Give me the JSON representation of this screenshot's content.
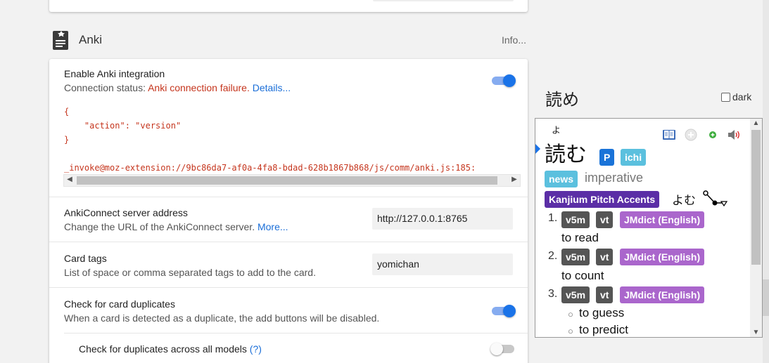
{
  "section": {
    "title": "Anki",
    "info_link": "Info..."
  },
  "anki_integration": {
    "label": "Enable Anki integration",
    "status_prefix": "Connection status: ",
    "status_value": "Anki connection failure.",
    "details_link": "Details...",
    "enabled": true,
    "error_lines": [
      "{",
      "    \"action\": \"version\"",
      "}",
      "_invoke@moz-extension://9bc86da7-af0a-4fa8-bdad-628b1867b868/js/comm/anki.js:185:"
    ]
  },
  "server_address": {
    "label": "AnkiConnect server address",
    "description": "Change the URL of the AnkiConnect server.",
    "more_link": "More...",
    "value": "http://127.0.0.1:8765"
  },
  "card_tags": {
    "label": "Card tags",
    "description": "List of space or comma separated tags to add to the card.",
    "value": "yomichan"
  },
  "duplicates": {
    "label": "Check for card duplicates",
    "description": "When a card is detected as a duplicate, the add buttons will be disabled.",
    "enabled": true
  },
  "duplicates_all_models": {
    "label": "Check for duplicates across all models",
    "help_link": "(?)",
    "enabled": false
  },
  "preview": {
    "title": "読め",
    "dark_label": "dark",
    "dark_checked": false,
    "reading": "よ",
    "headword": "読む",
    "tags": [
      "P",
      "ichi",
      "news"
    ],
    "inflection": "imperative",
    "pitch_tag": "Kanjium Pitch Accents",
    "pitch_reading": "よむ",
    "definitions": [
      {
        "number": "1.",
        "tags": [
          "v5m",
          "vt"
        ],
        "dictionary": "JMdict (English)",
        "glosses": [
          "to read"
        ]
      },
      {
        "number": "2.",
        "tags": [
          "v5m",
          "vt"
        ],
        "dictionary": "JMdict (English)",
        "glosses": [
          "to count"
        ]
      },
      {
        "number": "3.",
        "tags": [
          "v5m",
          "vt"
        ],
        "dictionary": "JMdict (English)",
        "glosses": [
          "to guess",
          "to predict"
        ]
      }
    ],
    "action_icons": [
      "book-icon",
      "add-kanji-icon",
      "add-term-icon",
      "speaker-icon"
    ]
  },
  "colors": {
    "accent": "#1a73e8",
    "error": "#c5351d",
    "link": "#1a6ed8",
    "tag_popular": "#1a73d8",
    "tag_frequency": "#5bc0de",
    "tag_pos": "#555555",
    "tag_dictionary": "#aa66cc",
    "tag_pitch": "#5b2ea6"
  }
}
